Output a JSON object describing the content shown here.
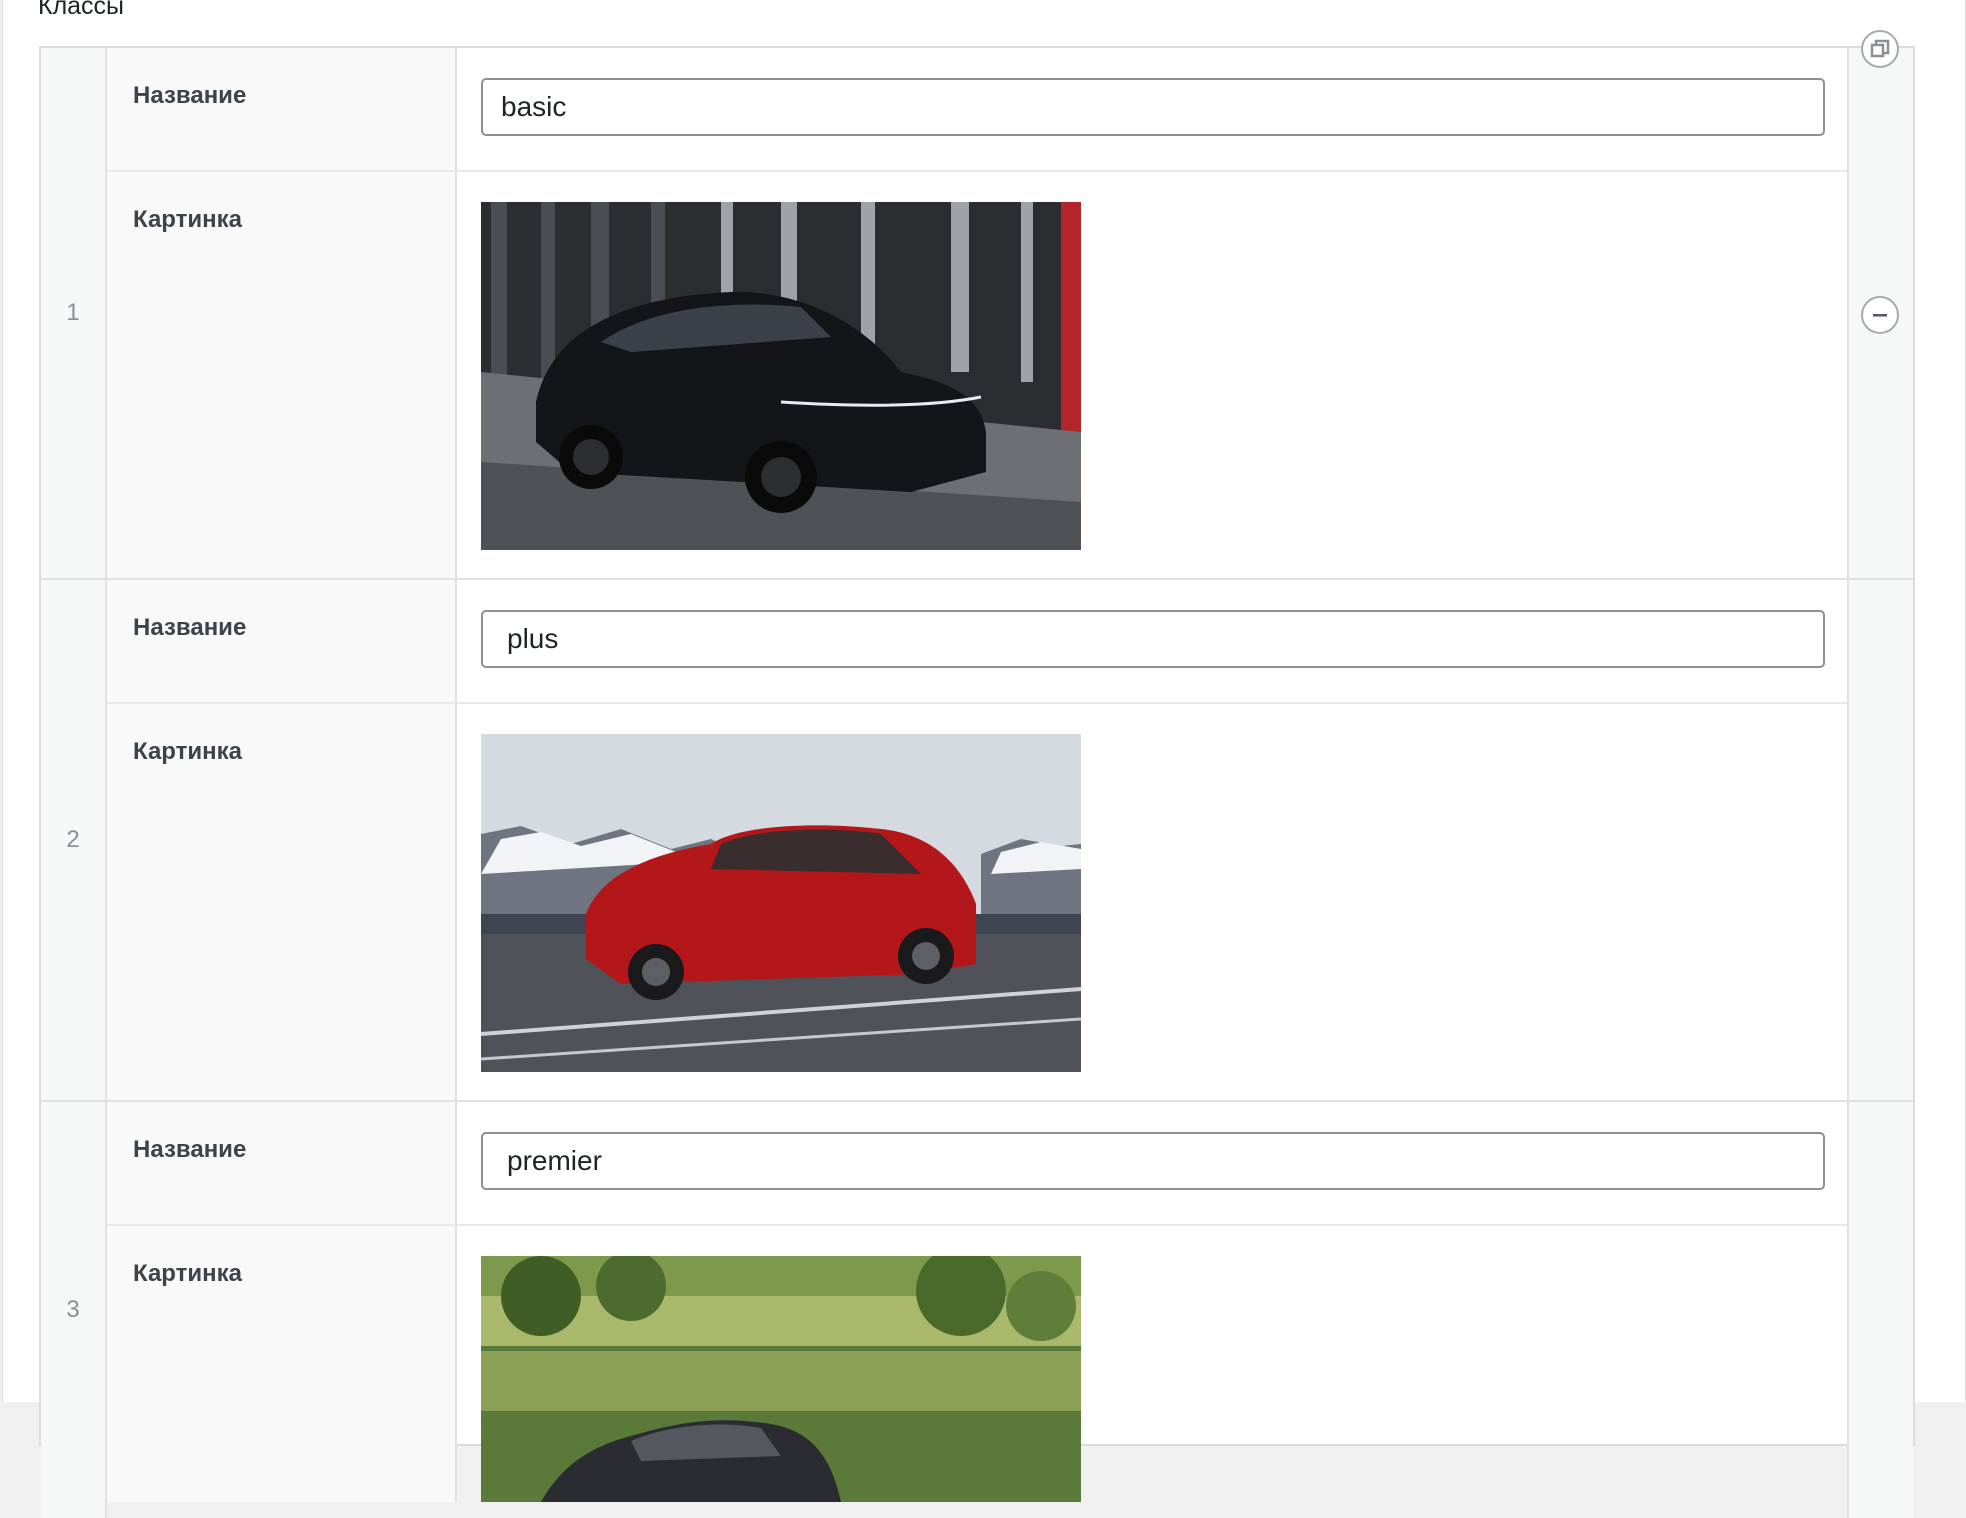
{
  "section": {
    "label": "Классы"
  },
  "rows": [
    {
      "index": "1",
      "name_label": "Название",
      "name_value": "basic",
      "image_label": "Картинка",
      "image_desc": "black sedan"
    },
    {
      "index": "2",
      "name_label": "Название",
      "name_value": "plus",
      "image_label": "Картинка",
      "image_desc": "red sedan"
    },
    {
      "index": "3",
      "name_label": "Название",
      "name_value": "premier",
      "image_label": "Картинка",
      "image_desc": "dark sedan"
    }
  ],
  "icons": {
    "duplicate": "duplicate-icon",
    "remove": "minus-circle-icon"
  },
  "colors": {
    "border": "#dcdcde",
    "label_bg": "#f9f9f9",
    "num_bg": "#f6f7f7",
    "text": "#1d2327"
  }
}
